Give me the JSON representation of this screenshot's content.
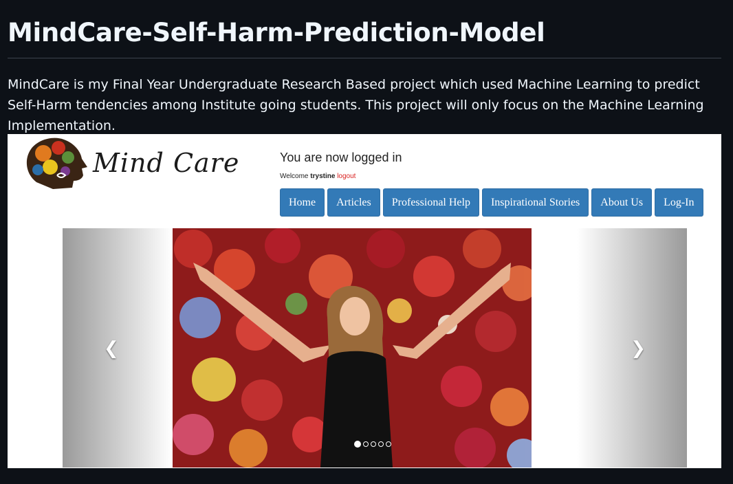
{
  "readme": {
    "title": "MindCare-Self-Harm-Prediction-Model",
    "description": "MindCare is my Final Year Undergraduate Research Based project which used Machine Learning to predict Self-Harm tendencies among Institute going students. This project will only focus on the Machine Learning Implementation."
  },
  "site": {
    "logo_text": "Mind Care",
    "status": "You are now logged in",
    "welcome_prefix": "Welcome",
    "username": "trystine",
    "logout": "logout",
    "nav": [
      "Home",
      "Articles",
      "Professional Help",
      "Inspirational Stories",
      "About Us",
      "Log-In"
    ],
    "colors": {
      "nav_bg": "#337ab7",
      "logout": "#d9201f"
    }
  },
  "carousel": {
    "prev_icon": "chevron-left-icon",
    "next_icon": "chevron-right-icon",
    "slide_count": 5,
    "active_slide": 1
  }
}
